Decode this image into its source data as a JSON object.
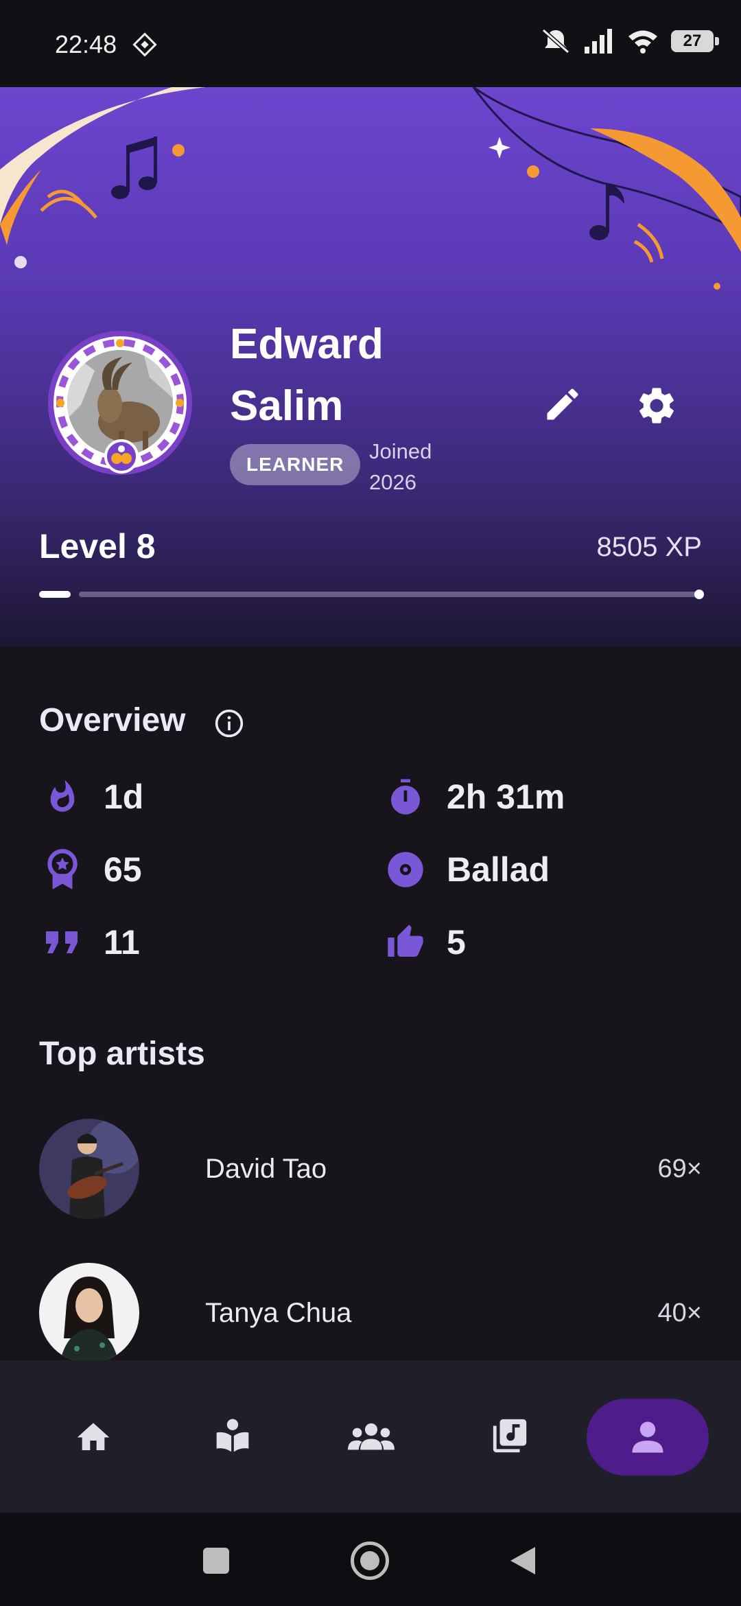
{
  "status_bar": {
    "time": "22:48",
    "battery": "27"
  },
  "profile": {
    "name_line1": "Edward",
    "name_line2": "Salim",
    "role": "LEARNER",
    "joined_line1": "Joined",
    "joined_line2": "2026",
    "level": "Level 8",
    "xp": "8505 XP",
    "level_progress_fraction": 0.05
  },
  "overview": {
    "title": "Overview",
    "stats": [
      {
        "icon": "flame-icon",
        "value": "1d"
      },
      {
        "icon": "stopwatch-icon",
        "value": "2h 31m"
      },
      {
        "icon": "award-ribbon-icon",
        "value": "65"
      },
      {
        "icon": "disc-icon",
        "value": "Ballad"
      },
      {
        "icon": "quote-icon",
        "value": "11"
      },
      {
        "icon": "thumbs-up-icon",
        "value": "5"
      }
    ]
  },
  "top_artists": {
    "title": "Top artists",
    "items": [
      {
        "name": "David Tao",
        "count": "69×"
      },
      {
        "name": "Tanya Chua",
        "count": "40×"
      }
    ]
  },
  "bottom_nav": [
    "home-icon",
    "learn-icon",
    "community-icon",
    "library-icon",
    "profile-icon"
  ],
  "colors": {
    "accent": "#7a57d6",
    "active_nav": "#4f1d8b",
    "background": "#17141c"
  }
}
